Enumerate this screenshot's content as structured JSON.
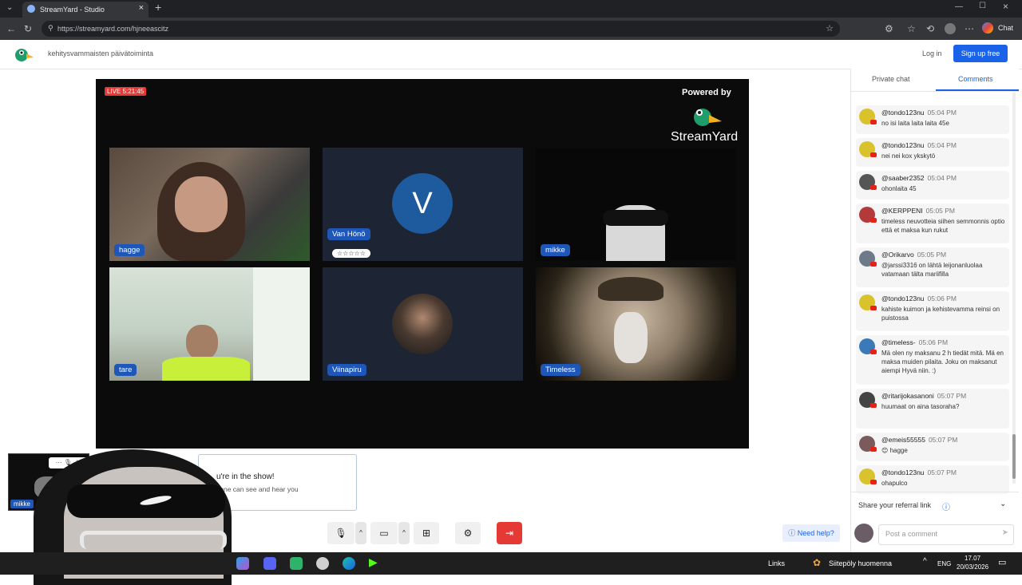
{
  "browser": {
    "tab_title": "StreamYard - Studio",
    "url": "https://streamyard.com/hjneeascitz",
    "chat_label": "Chat"
  },
  "header": {
    "show_title": "kehitysvammaisten päivätoiminta",
    "login": "Log in",
    "signup": "Sign up free"
  },
  "stage": {
    "live_badge": "LIVE 5:21:45",
    "powered_by": "Powered by",
    "brand": "StreamYard",
    "participants": [
      {
        "name": "hagge"
      },
      {
        "name": "Van Hönö",
        "initial": "V",
        "stars": "☆☆☆☆☆"
      },
      {
        "name": "mikke"
      },
      {
        "name": "tare"
      },
      {
        "name": "Viinapiru"
      },
      {
        "name": "Timeless"
      }
    ]
  },
  "notice": {
    "title": "u're in the show!",
    "subtitle": "yone can see and hear you"
  },
  "self_view": {
    "name": "mikke"
  },
  "panel": {
    "tabs": {
      "private": "Private chat",
      "comments": "Comments"
    },
    "comments": [
      {
        "user": "@tondo123nu",
        "time": "05:04 PM",
        "text": "no isi laita laita laita 45e",
        "color": "#d9c22c"
      },
      {
        "user": "@tondo123nu",
        "time": "05:04 PM",
        "text": "nei nei kox ykskytö",
        "color": "#d9c22c"
      },
      {
        "user": "@saaber2352",
        "time": "05:04 PM",
        "text": "ohonlaita 45",
        "color": "#555555"
      },
      {
        "user": "@KERPPENI",
        "time": "05:05 PM",
        "text": "timeless neuvotteia siihen semmonnis optio että et maksa kun rukut",
        "color": "#b23a3a"
      },
      {
        "user": "@Orikarvo",
        "time": "05:05 PM",
        "text": "@jarssi3316 on lähtä leijonanluolaa vatamaan tälta mariifilla",
        "color": "#6e7a8a"
      },
      {
        "user": "@tondo123nu",
        "time": "05:06 PM",
        "text": "kahiste kuimon ja kehistevamma reinsi on puistossa",
        "color": "#d9c22c"
      },
      {
        "user": "@timeless-",
        "time": "05:06 PM",
        "text": "Mä olen ny maksanu 2 h tiedät mitä. Mä en maksa muiden pilaita. Joku on maksanut aiempi Hyvä niin. :)",
        "color": "#3a7ab8"
      },
      {
        "user": "@ritarijokasanoni",
        "time": "05:07 PM",
        "text": "huumaat on aina tasoraha?",
        "color": "#444444"
      },
      {
        "user": "@emeis55555",
        "time": "05:07 PM",
        "text": "😊 hagge",
        "color": "#7a5a5a"
      },
      {
        "user": "@tondo123nu",
        "time": "05:07 PM",
        "text": "ohapulco",
        "color": "#d9c22c"
      }
    ],
    "referral": "Share your referral link",
    "comment_placeholder": "Post a comment"
  },
  "controls": {
    "help": "Need help?"
  },
  "taskbar": {
    "links": "Links",
    "weather": "Siitepöly huomenna",
    "lang": "ENG",
    "time": "17.07",
    "date": "20/03/2026"
  },
  "colors": {
    "accent": "#1a62e8",
    "live": "#e53935",
    "leave": "#e53935"
  }
}
